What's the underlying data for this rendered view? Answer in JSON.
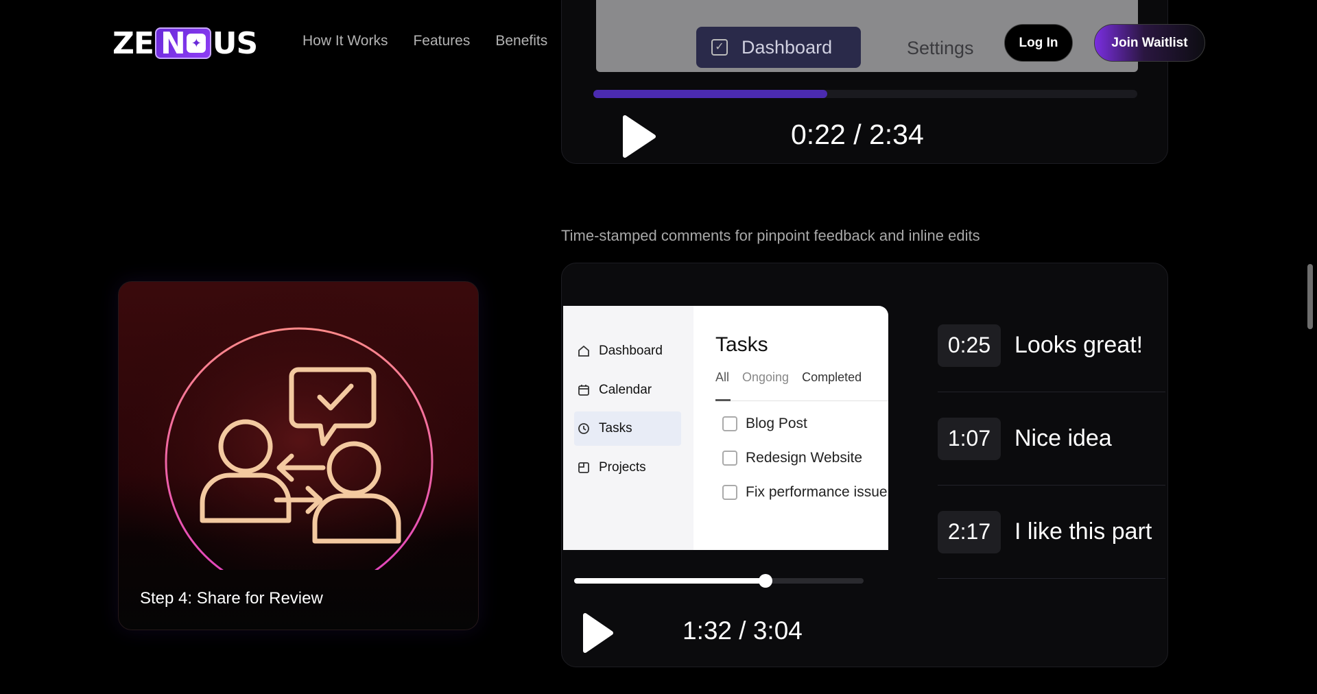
{
  "header": {
    "logo": {
      "left": "ZE",
      "chip": "N",
      "right": "US"
    },
    "nav": [
      {
        "label": "How It Works"
      },
      {
        "label": "Features"
      },
      {
        "label": "Benefits"
      }
    ],
    "login_label": "Log In",
    "waitlist_label": "Join Waitlist"
  },
  "top_video": {
    "tab_dashboard": "Dashboard",
    "tab_settings": "Settings",
    "progress": 0.43,
    "time": "0:22 / 2:34"
  },
  "caption": "Time-stamped comments for pinpoint feedback and inline edits",
  "step_card": {
    "title": "Step 4: Share for Review"
  },
  "video": {
    "sidebar": [
      {
        "label": "Dashboard",
        "icon": "home-icon"
      },
      {
        "label": "Calendar",
        "icon": "calendar-icon"
      },
      {
        "label": "Tasks",
        "icon": "tasks-icon",
        "active": true
      },
      {
        "label": "Projects",
        "icon": "projects-icon"
      }
    ],
    "title": "Tasks",
    "tabs": [
      "All",
      "Ongoing",
      "Completed"
    ],
    "tasks": [
      "Blog Post",
      "Redesign Website",
      "Fix performance issue"
    ],
    "comments": [
      {
        "time": "0:25",
        "text": "Looks great!"
      },
      {
        "time": "1:07",
        "text": "Nice idea"
      },
      {
        "time": "2:17",
        "text": "I like this part"
      }
    ],
    "progress": 0.66,
    "time": "1:32 / 3:04"
  },
  "colors": {
    "accent": "#7a2ee0",
    "background": "#000000"
  }
}
